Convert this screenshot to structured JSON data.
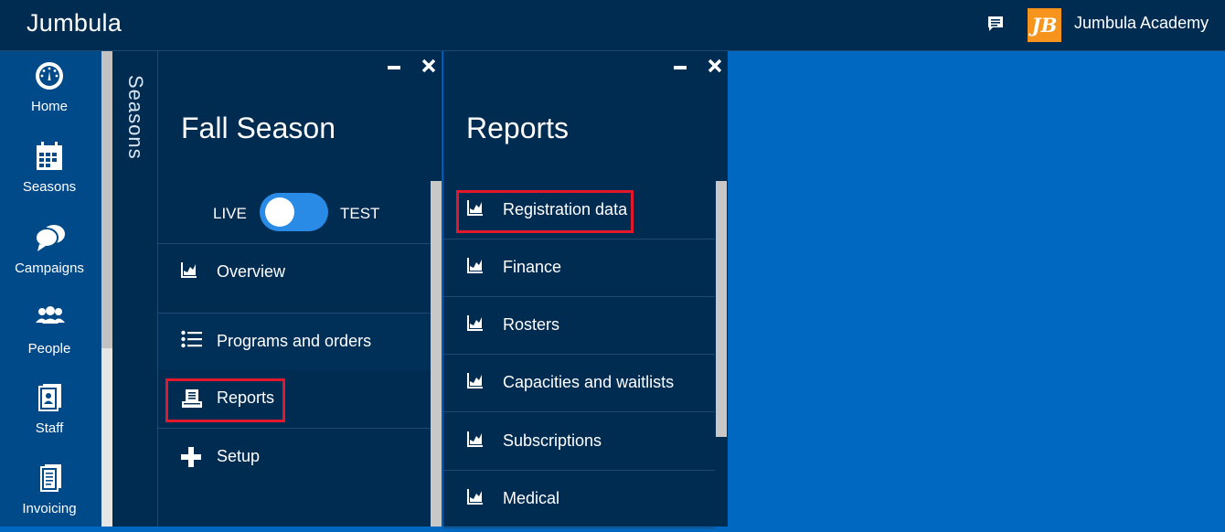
{
  "header": {
    "brand": "Jumbula",
    "org_logo_text": "JB",
    "org_name": "Jumbula Academy",
    "chat_icon": "chat-icon",
    "accent": "#f7941d"
  },
  "leftnav": {
    "items": [
      {
        "label": "Home",
        "icon": "gauge-icon"
      },
      {
        "label": "Seasons",
        "icon": "calendar-icon"
      },
      {
        "label": "Campaigns",
        "icon": "speech-bubbles-icon"
      },
      {
        "label": "People",
        "icon": "people-icon"
      },
      {
        "label": "Staff",
        "icon": "staff-badge-icon"
      },
      {
        "label": "Invoicing",
        "icon": "invoice-icon"
      }
    ]
  },
  "rail": {
    "label": "Seasons"
  },
  "season_panel": {
    "title": "Fall Season",
    "toggle": {
      "left_label": "LIVE",
      "right_label": "TEST",
      "state": "LIVE"
    },
    "menu": [
      {
        "label": "Overview",
        "icon": "chart-icon"
      },
      {
        "label": "Programs and orders",
        "icon": "list-icon"
      },
      {
        "label": "Reports",
        "icon": "reports-icon",
        "highlighted": true
      },
      {
        "label": "Setup",
        "icon": "plus-icon"
      }
    ]
  },
  "reports_panel": {
    "title": "Reports",
    "items": [
      {
        "label": "Registration data",
        "icon": "chart-icon",
        "highlighted": true
      },
      {
        "label": "Finance",
        "icon": "chart-icon"
      },
      {
        "label": "Rosters",
        "icon": "chart-icon"
      },
      {
        "label": "Capacities and waitlists",
        "icon": "chart-icon"
      },
      {
        "label": "Subscriptions",
        "icon": "chart-icon"
      },
      {
        "label": "Medical",
        "icon": "chart-icon"
      }
    ]
  },
  "colors": {
    "topbar": "#002c52",
    "leftnav": "#004a8a",
    "panel": "#002c52",
    "workspace": "#0068c0",
    "toggle": "#2a8be6",
    "highlight": "#e3182d"
  }
}
